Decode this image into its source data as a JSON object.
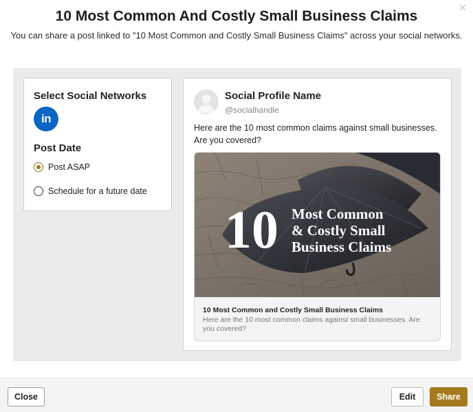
{
  "dialog": {
    "title": "10 Most Common And Costly Small Business Claims",
    "subtitle": "You can share a post linked to \"10 Most Common and Costly Small Business Claims\" across your social networks.",
    "close_icon": "close-icon"
  },
  "left": {
    "networks_heading": "Select Social Networks",
    "networks": [
      {
        "name": "linkedin",
        "label": "in",
        "color": "#0a66c2"
      }
    ],
    "post_date_heading": "Post Date",
    "options": [
      {
        "label": "Post ASAP",
        "selected": true
      },
      {
        "label": "Schedule for a future date",
        "selected": false
      }
    ]
  },
  "preview": {
    "profile_name": "Social Profile Name",
    "handle": "@socialhandle",
    "text": "Here are the 10 most common claims against small businesses. Are you covered?",
    "image": {
      "big_number": "10",
      "line1": "Most Common",
      "line2": "& Costly Small",
      "line3": "Business Claims"
    },
    "card_title": "10 Most Common and Costly Small Business Claims",
    "card_description": "Here are the 10 most common claims against small businesses. Are you covered?"
  },
  "footer": {
    "close_label": "Close",
    "edit_label": "Edit",
    "share_label": "Share"
  },
  "colors": {
    "accent": "#a37a1d",
    "linkedin": "#0a66c2"
  }
}
